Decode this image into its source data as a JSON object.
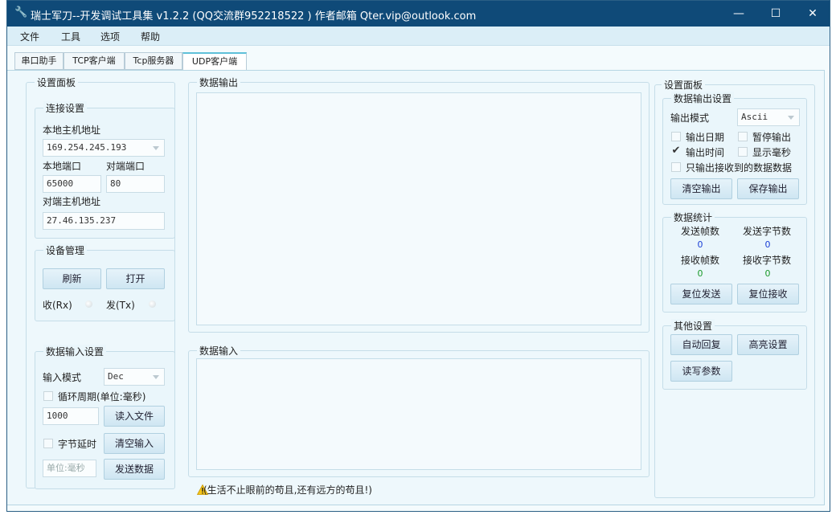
{
  "window": {
    "title": "瑞士军刀--开发调试工具集 v1.2.2 (QQ交流群952218522 ) 作者邮箱 Qter.vip@outlook.com",
    "minimize": "—",
    "maximize": "☐",
    "close": "✕"
  },
  "menu": [
    "文件",
    "工具",
    "选项",
    "帮助"
  ],
  "tabs": [
    "串口助手",
    "TCP客户端",
    "Tcp服务器",
    "UDP客户端"
  ],
  "left": {
    "panel_title": "设置面板",
    "conn": {
      "title": "连接设置",
      "local_host_label": "本地主机地址",
      "local_host_value": "169.254.245.193",
      "local_port_label": "本地端口",
      "local_port_value": "65000",
      "remote_port_label": "对端端口",
      "remote_port_value": "80",
      "remote_host_label": "对端主机地址",
      "remote_host_value": "27.46.135.237"
    },
    "device": {
      "title": "设备管理",
      "refresh": "刷新",
      "open": "打开",
      "rx": "收(Rx)",
      "tx": "发(Tx)"
    },
    "input": {
      "title": "数据输入设置",
      "mode_label": "输入模式",
      "mode_value": "Dec",
      "loop_label": "循环周期(单位:毫秒)",
      "loop_value": "1000",
      "read_file": "读入文件",
      "byte_delay": "字节延时",
      "clear_input": "清空输入",
      "unit_placeholder": "单位:毫秒",
      "send": "发送数据"
    }
  },
  "center": {
    "output_title": "数据输出",
    "input_title": "数据输入",
    "status": "(生活不止眼前的苟且,还有远方的苟且!)"
  },
  "right": {
    "panel_title": "设置面板",
    "output": {
      "title": "数据输出设置",
      "mode_label": "输出模式",
      "mode_value": "Ascii",
      "opt_date": "输出日期",
      "opt_pause": "暂停输出",
      "opt_time": "输出时间",
      "opt_ms": "显示毫秒",
      "opt_recv_only": "只输出接收到的数据数据",
      "clear": "清空输出",
      "save": "保存输出"
    },
    "stats": {
      "title": "数据统计",
      "send_frames_label": "发送帧数",
      "send_bytes_label": "发送字节数",
      "send_frames": "0",
      "send_bytes": "0",
      "recv_frames_label": "接收帧数",
      "recv_bytes_label": "接收字节数",
      "recv_frames": "0",
      "recv_bytes": "0",
      "reset_send": "复位发送",
      "reset_recv": "复位接收"
    },
    "other": {
      "title": "其他设置",
      "auto_reply": "自动回复",
      "highlight": "高亮设置",
      "rw_params": "读写参数"
    }
  },
  "colors": {
    "titlebar": "#0f4a78",
    "send_count": "#1a3fd6",
    "recv_count": "#1a9a2a"
  }
}
